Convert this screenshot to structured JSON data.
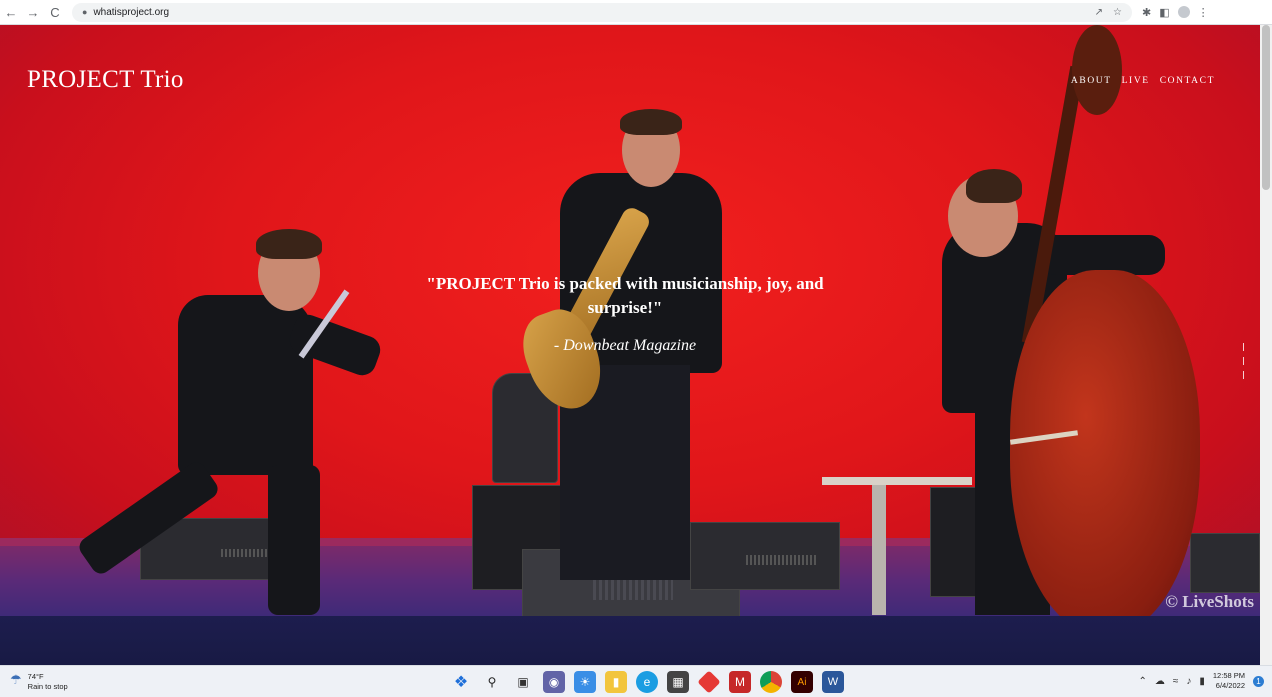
{
  "browser": {
    "url": "whatisproject.org",
    "back_icon": "←",
    "forward_icon": "→",
    "reload_icon": "C",
    "lock_icon": "🔒"
  },
  "site": {
    "title": "PROJECT Trio",
    "nav": {
      "about": "ABOUT",
      "live": "LIVE",
      "contact": "CONTACT"
    },
    "quote": "\"PROJECT Trio is packed with musicianship, joy, and surprise!\"",
    "attribution": "- Downbeat Magazine",
    "watermark": "© LiveShots"
  },
  "taskbar": {
    "weather_temp": "74°F",
    "weather_desc": "Rain to stop",
    "time": "12:58 PM",
    "date": "6/4/2022",
    "notification_count": "1"
  },
  "colors": {
    "hero_red": "#e0161a",
    "band_navy": "#1d1d4e"
  }
}
